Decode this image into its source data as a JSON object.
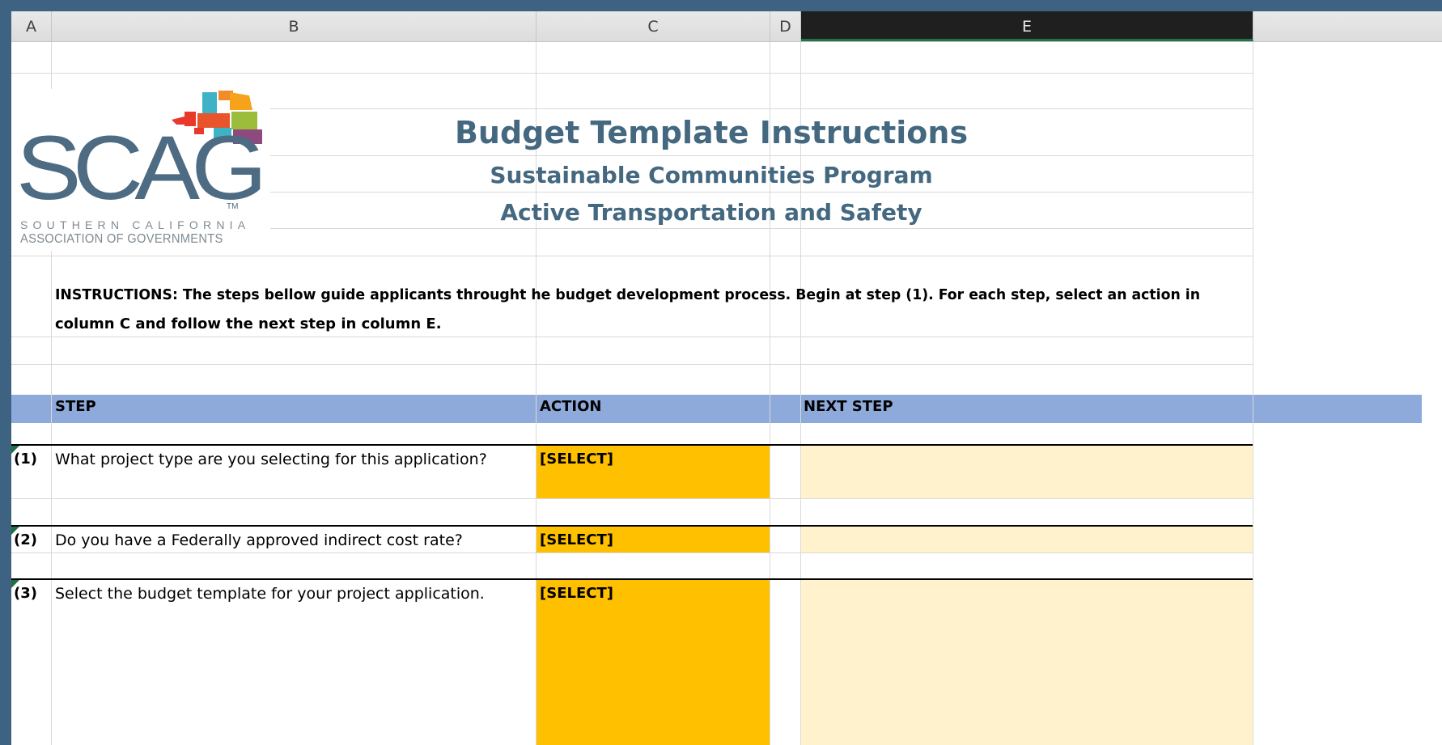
{
  "columns": [
    "A",
    "B",
    "C",
    "D",
    "E"
  ],
  "selected_column": "E",
  "logo": {
    "wordmark": "SCAG",
    "trademark": "TM",
    "line1": "SOUTHERN CALIFORNIA",
    "line2": "ASSOCIATION OF GOVERNMENTS"
  },
  "titles": {
    "main": "Budget Template Instructions",
    "sub1": "Sustainable Communities Program",
    "sub2": "Active Transportation and Safety"
  },
  "instructions": {
    "line1": "INSTRUCTIONS: The steps bellow guide applicants throught he budget development process. Begin at step (1). For each step, select an action in",
    "line2": "column C and follow the next step in column E."
  },
  "table": {
    "headers": {
      "step": "STEP",
      "action": "ACTION",
      "next": "NEXT STEP"
    },
    "rows": [
      {
        "num": "(1)",
        "question": "What project type are you selecting for this application?",
        "action": "[SELECT]"
      },
      {
        "num": "(2)",
        "question": "Do you have a Federally approved indirect cost rate?",
        "action": "[SELECT]"
      },
      {
        "num": "(3)",
        "question": "Select the budget template for your project application.",
        "action": "[SELECT]"
      }
    ]
  },
  "colors": {
    "header_band": "#8eaadb",
    "select_fill": "#ffc000",
    "next_fill": "#fff2cc",
    "title_color": "#44687f",
    "window_bg": "#3e6282"
  }
}
